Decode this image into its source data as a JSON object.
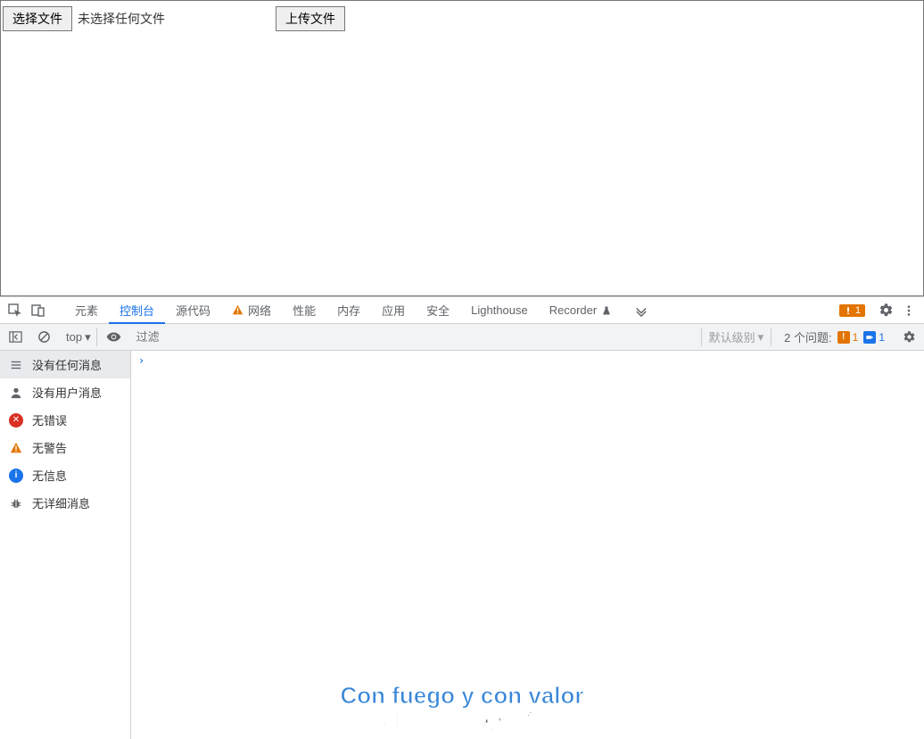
{
  "page": {
    "choose_file_label": "选择文件",
    "file_status": "未选择任何文件",
    "upload_label": "上传文件"
  },
  "devtools": {
    "tabs": {
      "elements": "元素",
      "console": "控制台",
      "sources": "源代码",
      "network": "网络",
      "performance": "性能",
      "memory": "内存",
      "application": "应用",
      "security": "安全",
      "lighthouse": "Lighthouse",
      "recorder": "Recorder"
    },
    "warn_count": "1",
    "toolbar": {
      "top_label": "top",
      "filter_placeholder": "过滤",
      "levels_label": "默认级别",
      "issues_label": "2 个问题:",
      "issue_warn_count": "1",
      "issue_info_count": "1"
    },
    "sidebar": {
      "no_messages": "没有任何消息",
      "no_user": "没有用户消息",
      "no_errors": "无错误",
      "no_warnings": "无警告",
      "no_info": "无信息",
      "no_verbose": "无详细消息"
    }
  },
  "captions": {
    "line1": "Con fuego y con valor",
    "line2": "心中怀着热忱和勇气"
  }
}
